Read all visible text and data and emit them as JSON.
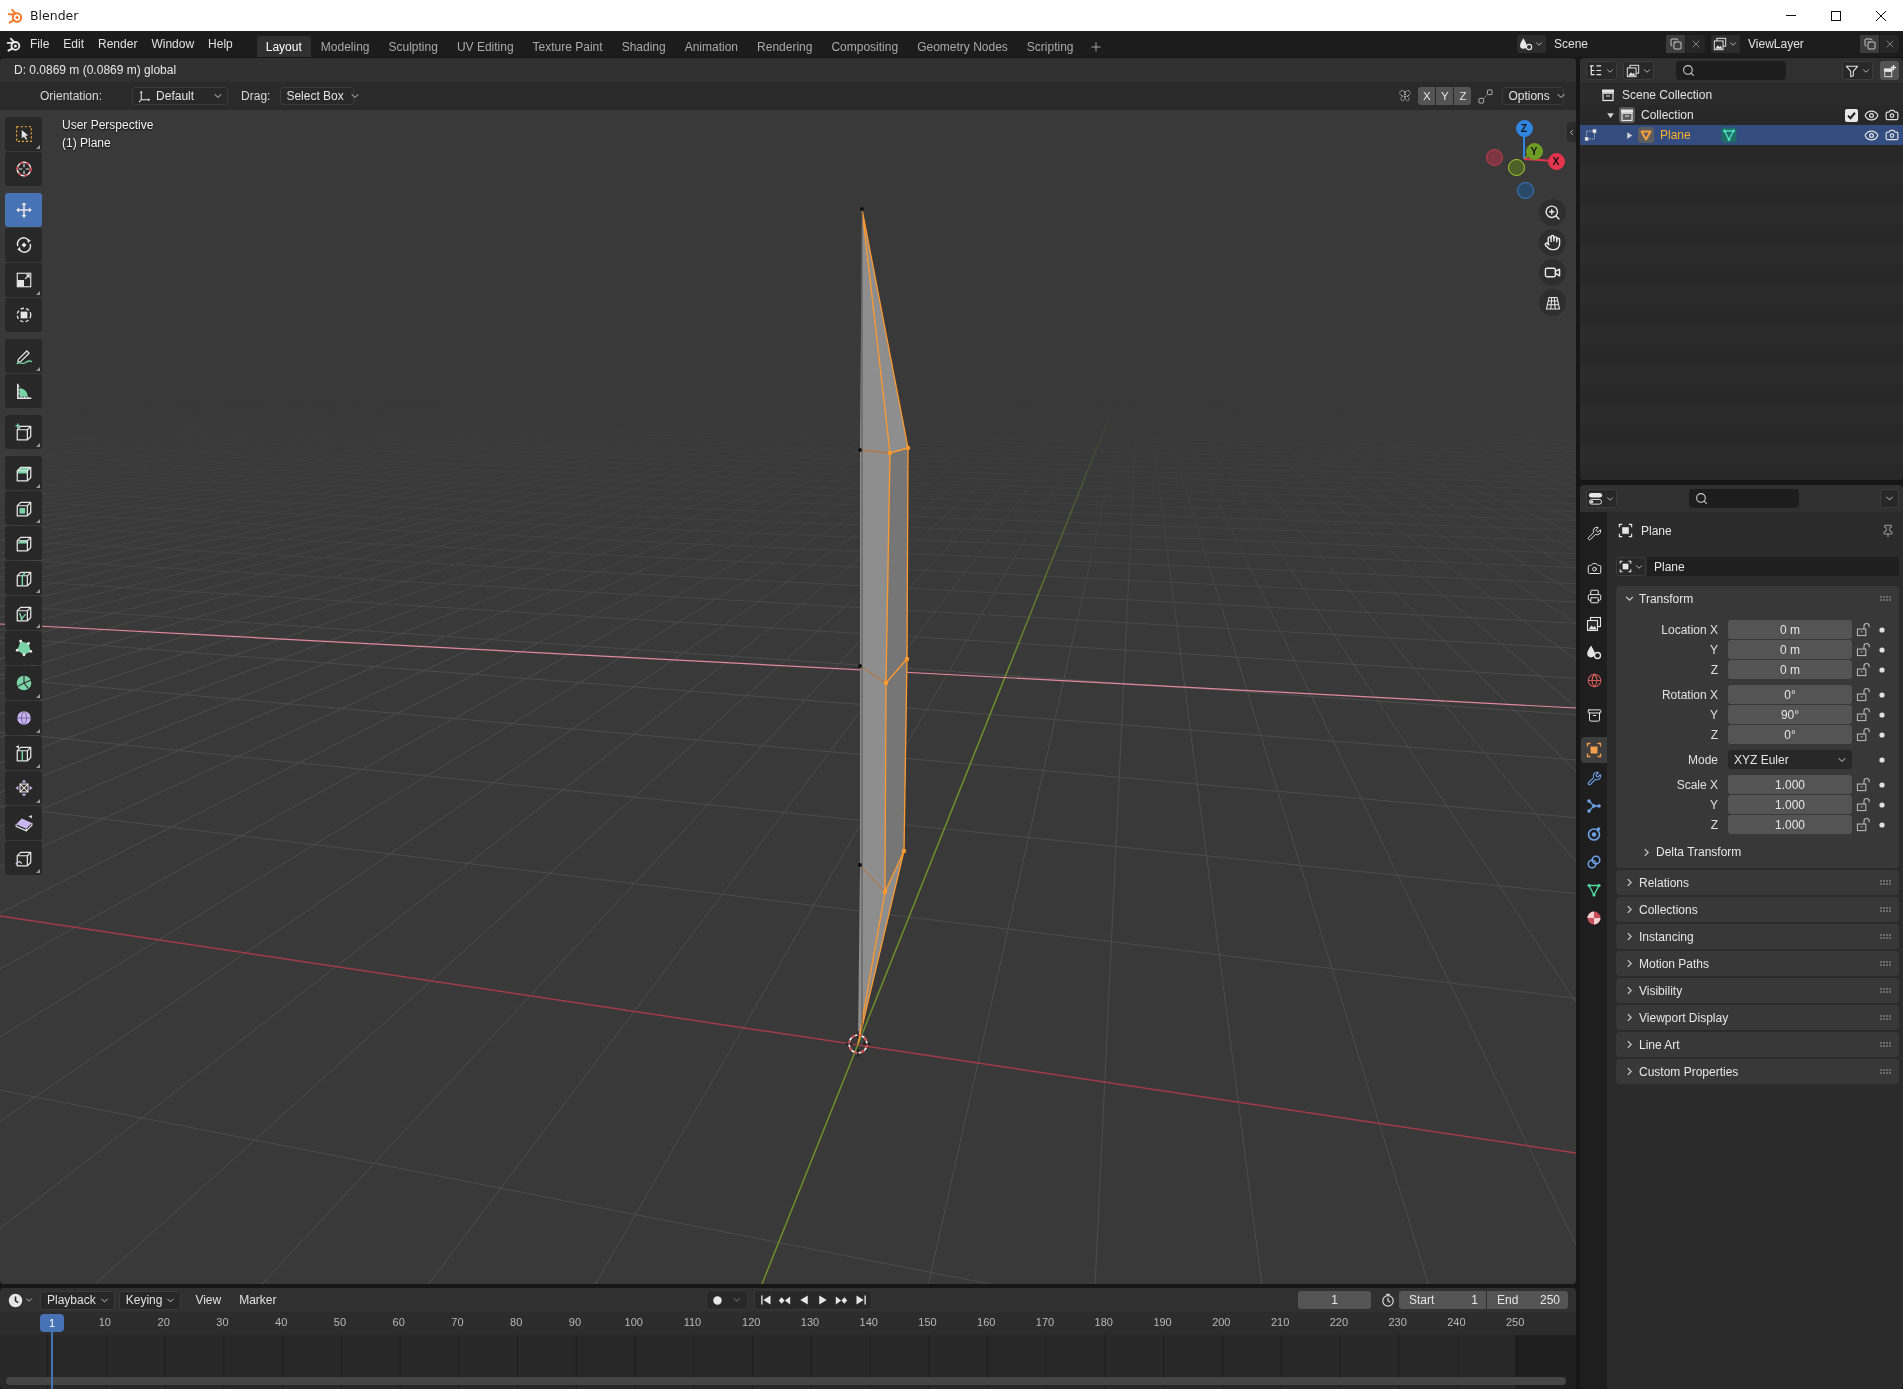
{
  "window": {
    "title": "Blender"
  },
  "top_bar": {
    "menus": [
      "File",
      "Edit",
      "Render",
      "Window",
      "Help"
    ],
    "workspaces": [
      {
        "label": "Layout",
        "selected": true
      },
      {
        "label": "Modeling",
        "selected": false
      },
      {
        "label": "Sculpting",
        "selected": false
      },
      {
        "label": "UV Editing",
        "selected": false
      },
      {
        "label": "Texture Paint",
        "selected": false
      },
      {
        "label": "Shading",
        "selected": false
      },
      {
        "label": "Animation",
        "selected": false
      },
      {
        "label": "Rendering",
        "selected": false
      },
      {
        "label": "Compositing",
        "selected": false
      },
      {
        "label": "Geometry Nodes",
        "selected": false
      },
      {
        "label": "Scripting",
        "selected": false
      }
    ],
    "scene": "Scene",
    "view_layer": "ViewLayer"
  },
  "viewport": {
    "header_status": "D: 0.0869 m (0.0869 m) global",
    "orientation_label": "Orientation:",
    "orientation": "Default",
    "drag_label": "Drag:",
    "drag": "Select Box",
    "axis_toggles": [
      {
        "label": "X",
        "selected": false
      },
      {
        "label": "Y",
        "selected": false
      },
      {
        "label": "Z",
        "selected": false
      }
    ],
    "options": "Options",
    "view_name": "User Perspective",
    "object_info": "(1) Plane",
    "tool_groups": [
      [
        {
          "kind": "select_box",
          "selected": false,
          "submenu": true
        },
        {
          "kind": "cursor",
          "selected": false,
          "submenu": false
        }
      ],
      [
        {
          "kind": "move",
          "selected": true,
          "submenu": false
        },
        {
          "kind": "rotate",
          "selected": false,
          "submenu": false
        },
        {
          "kind": "scale",
          "selected": false,
          "submenu": true
        },
        {
          "kind": "transform",
          "selected": false,
          "submenu": false
        }
      ],
      [
        {
          "kind": "annotate",
          "selected": false,
          "submenu": true
        },
        {
          "kind": "measure",
          "selected": false,
          "submenu": false
        }
      ],
      [
        {
          "kind": "add_cube",
          "selected": false,
          "submenu": true
        }
      ],
      [
        {
          "kind": "extrude",
          "selected": false,
          "submenu": true
        },
        {
          "kind": "inset",
          "selected": false,
          "submenu": true
        },
        {
          "kind": "bevel",
          "selected": false,
          "submenu": false
        },
        {
          "kind": "loop_cut",
          "selected": false,
          "submenu": true
        },
        {
          "kind": "knife",
          "selected": false,
          "submenu": true
        },
        {
          "kind": "poly_build",
          "selected": false,
          "submenu": false
        },
        {
          "kind": "spin",
          "selected": false,
          "submenu": true
        },
        {
          "kind": "smooth",
          "selected": false,
          "submenu": true
        },
        {
          "kind": "edge_slide",
          "selected": false,
          "submenu": true
        },
        {
          "kind": "shrink_fatten",
          "selected": false,
          "submenu": true
        },
        {
          "kind": "shear",
          "selected": false,
          "submenu": false
        },
        {
          "kind": "rip",
          "selected": false,
          "submenu": true
        }
      ]
    ],
    "gizmo_axes": [
      {
        "label": "Z"
      },
      {
        "label": "Y"
      },
      {
        "label": "X"
      }
    ]
  },
  "outliner": {
    "tree": [
      {
        "kind": "scene_collection",
        "label": "Scene Collection",
        "selected": false,
        "active": false,
        "children": [
          {
            "kind": "collection",
            "label": "Collection",
            "selected": false,
            "active": true,
            "expanded": true,
            "checked": true,
            "children": [
              {
                "kind": "mesh_object",
                "label": "Plane",
                "selected": true,
                "active": true,
                "expanded": false
              }
            ]
          }
        ]
      }
    ]
  },
  "properties": {
    "tab_groups": [
      [
        {
          "kind": "tool",
          "selected": false
        }
      ],
      [
        {
          "kind": "render",
          "selected": false
        },
        {
          "kind": "output",
          "selected": false
        },
        {
          "kind": "view_layer",
          "selected": false
        },
        {
          "kind": "scene",
          "selected": false
        },
        {
          "kind": "world",
          "selected": false
        }
      ],
      [
        {
          "kind": "collection",
          "selected": false
        }
      ],
      [
        {
          "kind": "object",
          "selected": true
        },
        {
          "kind": "modifiers",
          "selected": false
        },
        {
          "kind": "particles",
          "selected": false
        },
        {
          "kind": "physics",
          "selected": false
        },
        {
          "kind": "constraints",
          "selected": false
        },
        {
          "kind": "data",
          "selected": false
        },
        {
          "kind": "material",
          "selected": false
        }
      ]
    ],
    "context_title": "Plane",
    "object_name": "Plane",
    "panels": [
      {
        "title": "Transform",
        "expanded": true,
        "groups": [
          [
            {
              "kind": "number",
              "label": "Location X",
              "value": "0 m",
              "locked": false
            },
            {
              "kind": "number",
              "label": "Y",
              "value": "0 m",
              "locked": false
            },
            {
              "kind": "number",
              "label": "Z",
              "value": "0 m",
              "locked": false
            }
          ],
          [
            {
              "kind": "number",
              "label": "Rotation X",
              "value": "0°",
              "locked": false
            },
            {
              "kind": "number",
              "label": "Y",
              "value": "90°",
              "locked": false
            },
            {
              "kind": "number",
              "label": "Z",
              "value": "0°",
              "locked": false
            }
          ],
          [
            {
              "kind": "dropdown",
              "label": "Mode",
              "value": "XYZ Euler"
            }
          ],
          [
            {
              "kind": "number",
              "label": "Scale X",
              "value": "1.000",
              "locked": false
            },
            {
              "kind": "number",
              "label": "Y",
              "value": "1.000",
              "locked": false
            },
            {
              "kind": "number",
              "label": "Z",
              "value": "1.000",
              "locked": false
            }
          ]
        ],
        "subpanels": [
          {
            "title": "Delta Transform",
            "expanded": false
          }
        ]
      },
      {
        "title": "Relations",
        "expanded": false
      },
      {
        "title": "Collections",
        "expanded": false
      },
      {
        "title": "Instancing",
        "expanded": false
      },
      {
        "title": "Motion Paths",
        "expanded": false
      },
      {
        "title": "Visibility",
        "expanded": false
      },
      {
        "title": "Viewport Display",
        "expanded": false
      },
      {
        "title": "Line Art",
        "expanded": false
      },
      {
        "title": "Custom Properties",
        "expanded": false
      }
    ]
  },
  "timeline": {
    "menus": [
      {
        "label": "Playback",
        "dropdown": true
      },
      {
        "label": "Keying",
        "dropdown": true
      },
      {
        "label": "View",
        "dropdown": false
      },
      {
        "label": "Marker",
        "dropdown": false
      }
    ],
    "auto_keying": false,
    "current_frame": "1",
    "start_label": "Start",
    "start": "1",
    "end_label": "End",
    "end": "250",
    "playhead_label": "1",
    "frame_labels": [
      "10",
      "20",
      "30",
      "40",
      "50",
      "60",
      "70",
      "80",
      "90",
      "100",
      "110",
      "120",
      "130",
      "140",
      "150",
      "160",
      "170",
      "180",
      "190",
      "200",
      "210",
      "220",
      "230",
      "240",
      "250"
    ]
  }
}
